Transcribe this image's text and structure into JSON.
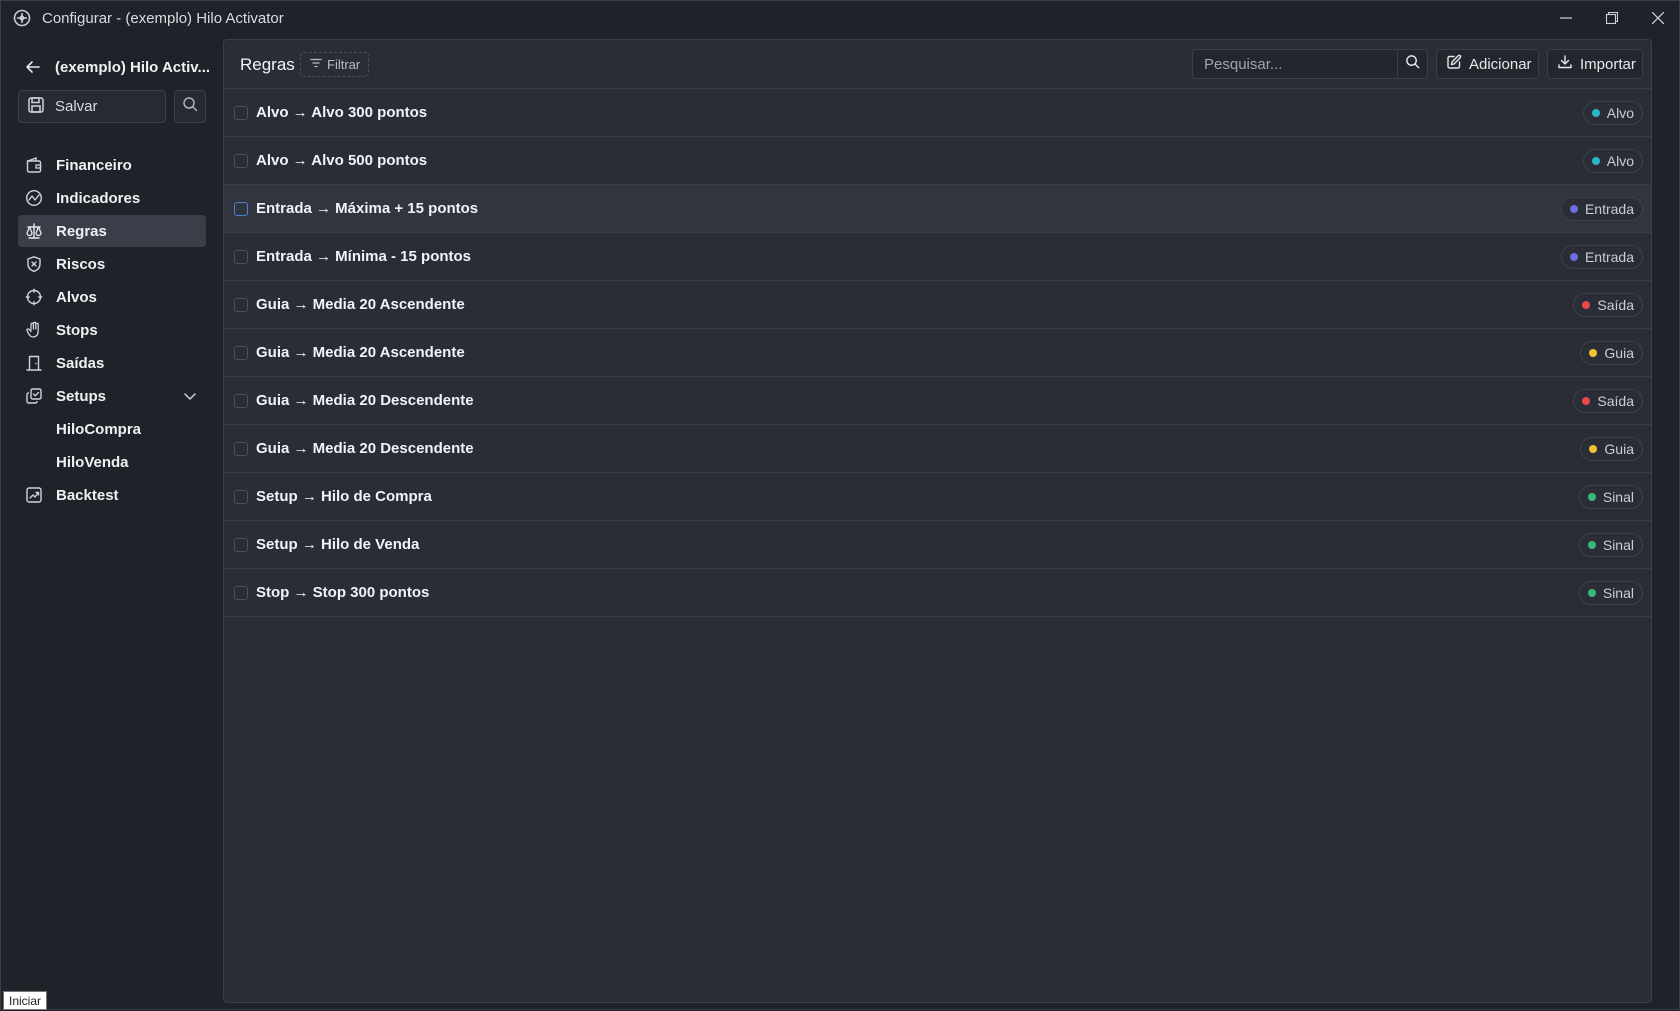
{
  "window": {
    "title": "Configurar - (exemplo) Hilo Activator"
  },
  "sidebar": {
    "project_title": "(exemplo) Hilo Activ...",
    "save_label": "Salvar",
    "items": [
      {
        "label": "Financeiro",
        "icon": "wallet-icon"
      },
      {
        "label": "Indicadores",
        "icon": "activity-icon"
      },
      {
        "label": "Regras",
        "icon": "scale-icon",
        "active": true
      },
      {
        "label": "Riscos",
        "icon": "shield-x-icon"
      },
      {
        "label": "Alvos",
        "icon": "crosshair-icon"
      },
      {
        "label": "Stops",
        "icon": "hand-icon"
      },
      {
        "label": "Saídas",
        "icon": "door-icon"
      },
      {
        "label": "Setups",
        "icon": "copy-check-icon",
        "expanded": true
      },
      {
        "label": "Backtest",
        "icon": "chart-line-icon"
      }
    ],
    "setups_children": [
      "HiloCompra",
      "HiloVenda"
    ]
  },
  "main": {
    "title": "Regras",
    "filter_label": "Filtrar",
    "search_placeholder": "Pesquisar...",
    "add_label": "Adicionar",
    "import_label": "Importar",
    "rules": [
      {
        "name": "Alvo → Alvo 300 pontos",
        "tag": "Alvo",
        "color": "#2bb5c9"
      },
      {
        "name": "Alvo → Alvo 500 pontos",
        "tag": "Alvo",
        "color": "#2bb5c9"
      },
      {
        "name": "Entrada → Máxima + 15 pontos",
        "tag": "Entrada",
        "color": "#6b6fe0",
        "hover": true
      },
      {
        "name": "Entrada → Mínima - 15 pontos",
        "tag": "Entrada",
        "color": "#6b6fe0"
      },
      {
        "name": "Guia → Media 20 Ascendente",
        "tag": "Saída",
        "color": "#e5484d"
      },
      {
        "name": "Guia → Media 20 Ascendente",
        "tag": "Guia",
        "color": "#f1c232"
      },
      {
        "name": "Guia → Media 20 Descendente",
        "tag": "Saída",
        "color": "#e5484d"
      },
      {
        "name": "Guia → Media 20 Descendente",
        "tag": "Guia",
        "color": "#f1c232"
      },
      {
        "name": "Setup → Hilo de Compra",
        "tag": "Sinal",
        "color": "#35b87a"
      },
      {
        "name": "Setup → Hilo de Venda",
        "tag": "Sinal",
        "color": "#35b87a"
      },
      {
        "name": "Stop → Stop 300 pontos",
        "tag": "Sinal",
        "color": "#35b87a"
      }
    ]
  },
  "status_tooltip": "Iniciar"
}
